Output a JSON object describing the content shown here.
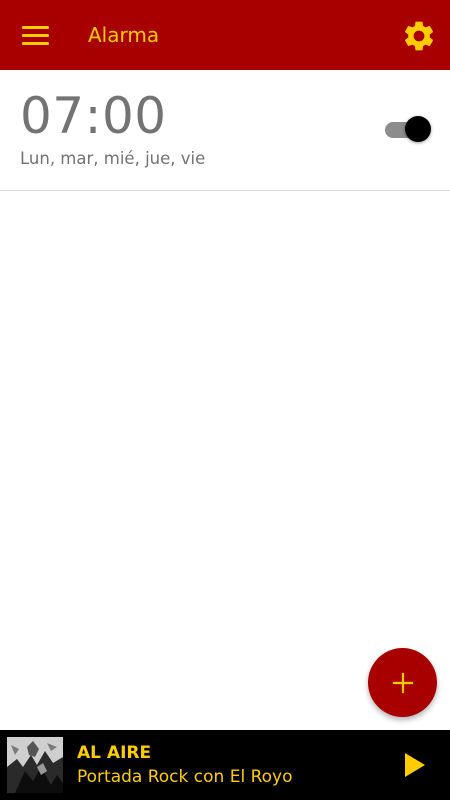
{
  "colors": {
    "brand_red": "#a80000",
    "accent_yellow": "#ffcc00",
    "text_gray": "#737373",
    "player_bg": "#000000"
  },
  "toolbar": {
    "menu_icon": "hamburger-menu-icon",
    "title": "Alarma",
    "settings_icon": "gear-icon"
  },
  "alarms": [
    {
      "time": "07:00",
      "days": "Lun, mar, mié, jue, vie",
      "enabled": true
    }
  ],
  "fab": {
    "icon": "plus-icon"
  },
  "player": {
    "status": "AL AIRE",
    "show": "Portada Rock con El Royo",
    "play_icon": "play-icon"
  }
}
